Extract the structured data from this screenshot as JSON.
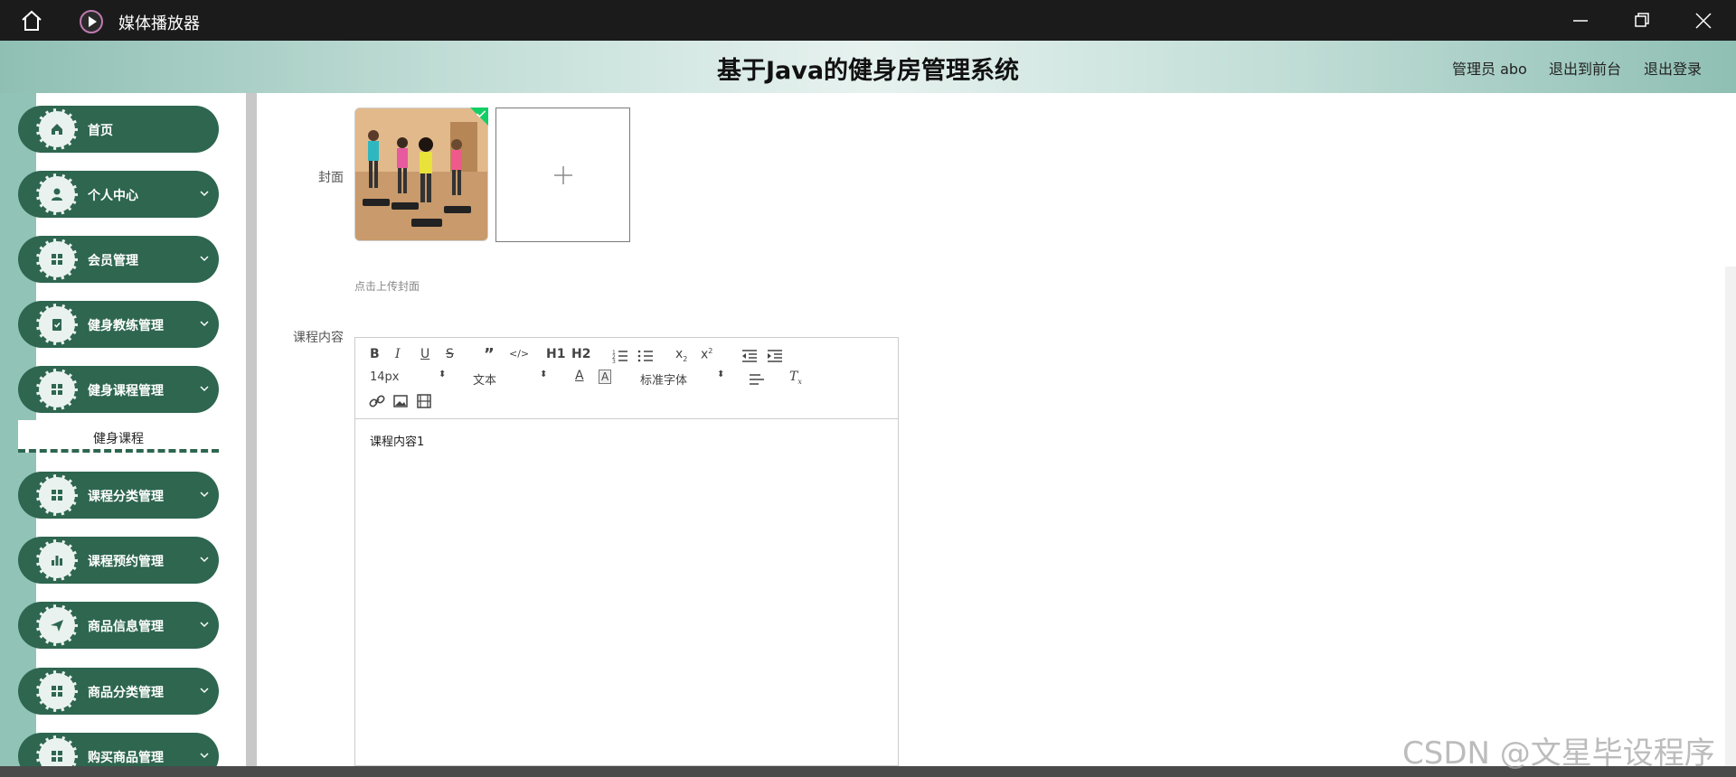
{
  "window": {
    "app_title": "媒体播放器"
  },
  "header": {
    "system_title": "基于Java的健身房管理系统",
    "admin_label": "管理员 abo",
    "to_front_label": "退出到前台",
    "logout_label": "退出登录"
  },
  "sidebar": {
    "items": [
      {
        "label": "首页",
        "icon": "home-icon",
        "has_chevron": false
      },
      {
        "label": "个人中心",
        "icon": "user-icon",
        "has_chevron": true
      },
      {
        "label": "会员管理",
        "icon": "grid-icon",
        "has_chevron": true
      },
      {
        "label": "健身教练管理",
        "icon": "clipboard-check-icon",
        "has_chevron": true
      },
      {
        "label": "健身课程管理",
        "icon": "grid-icon",
        "has_chevron": true
      },
      {
        "label": "课程分类管理",
        "icon": "grid-icon",
        "has_chevron": true
      },
      {
        "label": "课程预约管理",
        "icon": "bar-chart-icon",
        "has_chevron": true
      },
      {
        "label": "商品信息管理",
        "icon": "send-icon",
        "has_chevron": true
      },
      {
        "label": "商品分类管理",
        "icon": "grid-icon",
        "has_chevron": true
      },
      {
        "label": "购买商品管理",
        "icon": "grid-icon",
        "has_chevron": true
      }
    ],
    "sub_item": "健身课程"
  },
  "form": {
    "cover_label": "封面",
    "cover_hint": "点击上传封面",
    "content_label": "课程内容"
  },
  "editor": {
    "font_size": "14px",
    "paragraph": "文本",
    "font_family": "标准字体",
    "content": "课程内容1",
    "h1": "H1",
    "h2": "H2"
  },
  "watermark": "CSDN @文星毕设程序",
  "colors": {
    "sidebar_item": "#2e6650",
    "sidebar_bg": "#92c3b7",
    "titlebar": "#1b1b1b"
  }
}
